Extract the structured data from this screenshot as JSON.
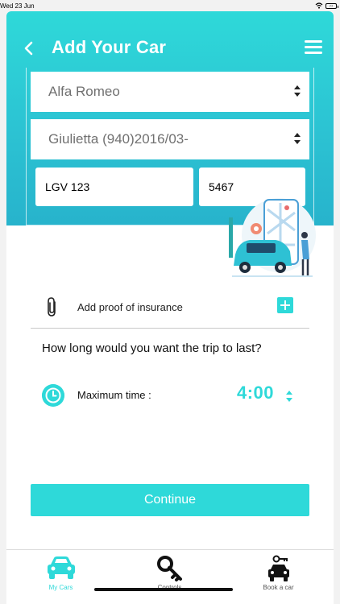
{
  "status_bar": {
    "time": "Wed 23 Jun",
    "battery": "77"
  },
  "header": {
    "title": "Add Your Car"
  },
  "form": {
    "make": "Alfa Romeo",
    "model": "Giulietta (940)2016/03-",
    "plate": "LGV 123",
    "code": "5467"
  },
  "insurance": {
    "label": "Add proof of insurance"
  },
  "trip": {
    "question": "How long would you want the trip to last?",
    "max_label": "Maximum time :",
    "max_value": "4:00"
  },
  "actions": {
    "continue": "Continue"
  },
  "tabs": [
    {
      "label": "My Cars",
      "active": true
    },
    {
      "label": "Controls",
      "active": false
    },
    {
      "label": "Book a car",
      "active": false
    }
  ],
  "colors": {
    "accent": "#2ed9d9",
    "header_dark": "#27b3cc"
  }
}
